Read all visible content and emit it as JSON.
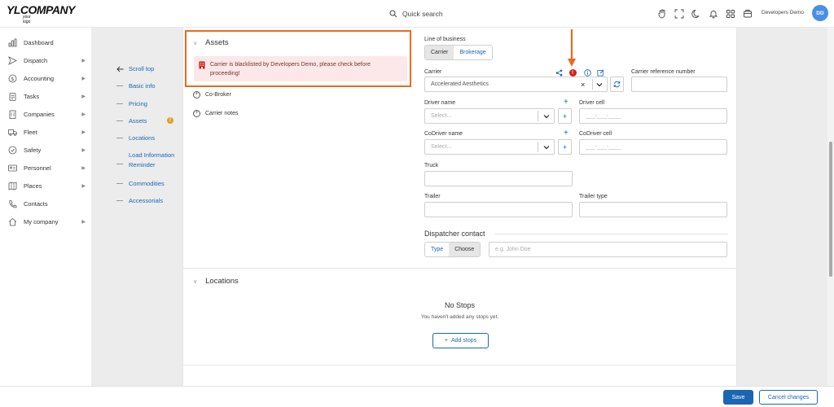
{
  "app": {
    "logo_text": "YLCOMPANY",
    "logo_sub": "your logo",
    "search_label": "Quick search",
    "user_name": "Developers Demo",
    "avatar_initials": "DD"
  },
  "sidebar": {
    "items": [
      {
        "label": "Dashboard",
        "icon": "bar-chart-icon",
        "caret": false
      },
      {
        "label": "Dispatch",
        "icon": "send-icon",
        "caret": true
      },
      {
        "label": "Accounting",
        "icon": "dollar-icon",
        "caret": true
      },
      {
        "label": "Tasks",
        "icon": "clipboard-icon",
        "caret": true
      },
      {
        "label": "Companies",
        "icon": "building-icon",
        "caret": true
      },
      {
        "label": "Fleet",
        "icon": "truck-icon",
        "caret": true
      },
      {
        "label": "Safety",
        "icon": "shield-check-icon",
        "caret": true
      },
      {
        "label": "Personnel",
        "icon": "id-card-icon",
        "caret": true
      },
      {
        "label": "Places",
        "icon": "map-icon",
        "caret": true
      },
      {
        "label": "Contacts",
        "icon": "phone-icon",
        "caret": false
      },
      {
        "label": "My company",
        "icon": "home-icon",
        "caret": true
      }
    ]
  },
  "scroll_nav": {
    "back_label": "Scroll top",
    "items": [
      "Basic info",
      "Pricing",
      "Assets",
      "Locations",
      "Load Information Reminder",
      "Commodities",
      "Accessorials"
    ],
    "assets_warning": "!"
  },
  "assets": {
    "title": "Assets",
    "alert_text": "Carrier is blacklisted by Developers Demo, please check before proceeding!",
    "co_broker_label": "Co-Broker",
    "carrier_notes_label": "Carrier notes"
  },
  "form": {
    "line_of_business_label": "Line of business",
    "lob_options": [
      "Carrier",
      "Brokerage"
    ],
    "carrier_label": "Carrier",
    "carrier_value": "Accelerated Aesthetics",
    "carrier_ref_label": "Carrier reference number",
    "driver_name_label": "Driver name",
    "driver_name_placeholder": "Select...",
    "driver_cell_label": "Driver cell",
    "driver_cell_placeholder": "___-___-____",
    "codriver_name_label": "CoDriver name",
    "codriver_name_placeholder": "Select...",
    "codriver_cell_label": "CoDriver cell",
    "codriver_cell_placeholder": "___-___-____",
    "truck_label": "Truck",
    "trailer_label": "Trailer",
    "trailer_type_label": "Trailer type",
    "dispatcher_title": "Dispatcher contact",
    "dispatcher_modes": [
      "Type",
      "Choose"
    ],
    "dispatcher_placeholder": "e.g. John Doe",
    "warning_badge": "!"
  },
  "locations": {
    "title": "Locations",
    "empty_title": "No Stops",
    "empty_sub": "You haven't added any stops yet.",
    "add_label": "Add stops"
  },
  "footer": {
    "save_label": "Save",
    "cancel_label": "Cancel changes"
  },
  "colors": {
    "accent": "#1a66b3",
    "annotation": "#ea6a1e",
    "alert_bg": "#fce8e8",
    "danger": "#d0201c",
    "warning": "#e0a020"
  }
}
